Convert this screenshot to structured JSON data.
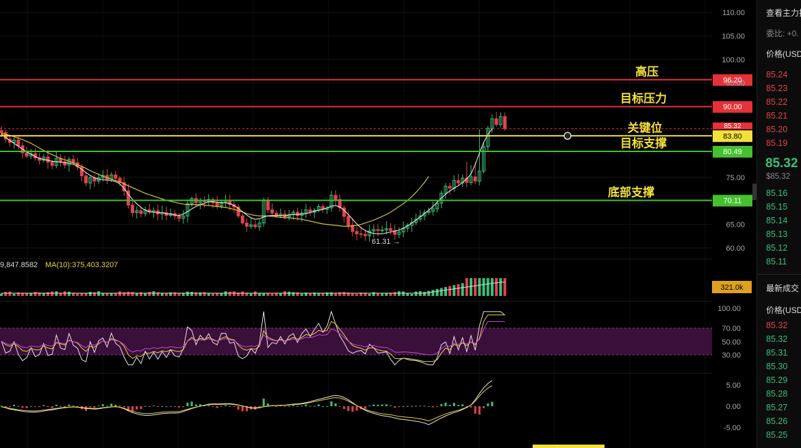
{
  "colors": {
    "up": "#3dbf7a",
    "down": "#e2444b",
    "ma_fast": "#e8e8e8",
    "ma_slow": "#e8d53a",
    "red_line": "#e53238",
    "yellow_line": "#f2e13b",
    "green_line": "#45c12e",
    "rsi_band": "#3a0f3a",
    "rsi_purple": "#c44bd6",
    "macd_hist": "#3dbf7a"
  },
  "price_axis": {
    "ticks": [
      "110.00",
      "105.00",
      "100.00",
      "95.00",
      "75.00",
      "65.00",
      "60.00"
    ]
  },
  "levels": [
    {
      "label": "高压",
      "tag": "96.20",
      "price": 95.7,
      "color": "red",
      "cursor": false
    },
    {
      "label": "目标压力",
      "tag": "90.00",
      "price": 90.0,
      "color": "red",
      "cursor": false
    },
    {
      "label": "关键位",
      "tag": "83.80",
      "price": 83.8,
      "color": "yellow",
      "cursor": true
    },
    {
      "label": "目标支撑",
      "tag": "80.49",
      "price": 80.49,
      "color": "green",
      "cursor": false
    },
    {
      "label": "底部支撑",
      "tag": "70.11",
      "price": 70.11,
      "color": "green",
      "cursor": false
    }
  ],
  "current_price_tag": "85.32",
  "low_marker": "61.31 →",
  "volume": {
    "label_value": "9,847.8582",
    "ma_label": "MA(10):375,403.3207",
    "tag": "321.0k"
  },
  "rsi_axis": [
    "100.00",
    "70.00",
    "50.00",
    "30.00"
  ],
  "macd_axis": [
    "5.00",
    "0.00",
    "-5.00"
  ],
  "chart_data": {
    "type": "candlestick",
    "close": [
      84.5,
      83.1,
      82.4,
      82.9,
      81.7,
      80.2,
      79.5,
      80.0,
      79.1,
      78.6,
      79.3,
      78.2,
      77.5,
      79.0,
      78.3,
      77.6,
      78.8,
      78.1,
      77.2,
      75.3,
      73.8,
      74.9,
      74.2,
      74.9,
      75.4,
      74.6,
      75.5,
      74.8,
      73.9,
      72.1,
      69.1,
      67.5,
      67.9,
      67.3,
      68.1,
      67.6,
      67.9,
      67.2,
      67.5,
      66.9,
      67.3,
      66.8,
      66.3,
      66.8,
      69.4,
      70.5,
      69.6,
      70.1,
      69.8,
      70.3,
      69.6,
      68.9,
      69.7,
      70.1,
      69.2,
      68.7,
      66.8,
      65.3,
      64.6,
      64.9,
      64.5,
      65.3,
      70.2,
      68.1,
      67.4,
      66.8,
      67.2,
      66.6,
      67.1,
      67.6,
      66.9,
      67.4,
      68.1,
      67.6,
      68.0,
      68.8,
      68.2,
      68.5,
      71.2,
      70.3,
      68.5,
      66.7,
      64.8,
      63.5,
      63.0,
      62.9,
      62.6,
      63.6,
      63.9,
      63.7,
      63.8,
      64.1,
      63.7,
      62.9,
      63.4,
      64.2,
      64.8,
      65.4,
      66.1,
      66.8,
      67.5,
      67.8,
      68.3,
      69.5,
      71.6,
      73.1,
      72.7,
      74.3,
      73.8,
      74.8,
      73.9,
      75.1,
      74.2,
      76.3,
      81.5,
      85.4,
      87.4,
      86.2,
      87.9,
      85.3
    ],
    "ma_fast": [
      84.2,
      83.5,
      82.8,
      82.2,
      81.6,
      81.0,
      80.4,
      79.9,
      79.4,
      79.0,
      78.8,
      78.6,
      78.4,
      78.3,
      78.2,
      78.1,
      78.0,
      77.8,
      77.3,
      76.7,
      76.0,
      75.4,
      74.9,
      74.6,
      74.5,
      74.4,
      74.3,
      74.1,
      73.6,
      72.6,
      71.4,
      70.3,
      69.4,
      68.6,
      68.0,
      67.7,
      67.6,
      67.5,
      67.5,
      67.3,
      67.2,
      67.0,
      66.9,
      67.2,
      67.7,
      68.3,
      68.8,
      69.2,
      69.5,
      69.8,
      69.8,
      69.7,
      69.6,
      69.6,
      69.4,
      69.0,
      68.4,
      67.7,
      67.0,
      66.4,
      66.1,
      66.2,
      66.6,
      66.8,
      66.9,
      66.9,
      66.9,
      66.8,
      67.0,
      67.1,
      67.1,
      67.2,
      67.3,
      67.5,
      67.8,
      68.0,
      68.2,
      68.5,
      68.9,
      69.0,
      68.7,
      68.0,
      67.1,
      66.1,
      65.1,
      64.3,
      63.7,
      63.3,
      63.1,
      63.0,
      63.0,
      63.2,
      63.4,
      63.6,
      63.8,
      64.2,
      64.7,
      65.3,
      65.9,
      66.6,
      67.3,
      68.0,
      68.8,
      69.7,
      70.6,
      71.4,
      72.1,
      72.7,
      73.2,
      73.9,
      74.7,
      75.7,
      77.7,
      80.2,
      82.4,
      84.1,
      85.3
    ],
    "ma_slow": [
      84.4,
      84.1,
      83.9,
      83.6,
      83.3,
      83.0,
      82.6,
      82.2,
      81.7,
      81.2,
      80.7,
      80.2,
      79.8,
      79.4,
      79.0,
      78.7,
      78.4,
      78.1,
      77.7,
      77.3,
      76.9,
      76.4,
      76.0,
      75.6,
      75.2,
      74.9,
      74.6,
      74.3,
      74.0,
      73.6,
      73.2,
      72.8,
      72.4,
      72.0,
      71.6,
      71.3,
      71.0,
      70.7,
      70.4,
      70.1,
      69.9,
      69.7,
      69.5,
      69.3,
      69.2,
      69.2,
      69.2,
      69.2,
      69.1,
      69.0,
      68.9,
      68.8,
      68.7,
      68.6,
      68.4,
      68.2,
      67.9,
      67.6,
      67.3,
      67.1,
      66.9,
      66.8,
      66.8,
      66.8,
      66.7,
      66.6,
      66.5,
      66.4,
      66.4,
      66.3,
      66.2,
      66.1,
      65.9,
      65.7,
      65.5,
      65.3,
      65.1,
      65.0,
      64.9,
      64.8,
      64.7,
      64.6,
      64.6,
      64.7,
      64.8,
      65.0,
      65.3,
      65.6,
      65.9,
      66.3,
      66.7,
      67.1,
      67.6,
      68.2,
      68.8,
      69.4,
      70.1,
      70.9,
      71.8,
      72.8,
      73.9,
      75.2
    ]
  }
}
